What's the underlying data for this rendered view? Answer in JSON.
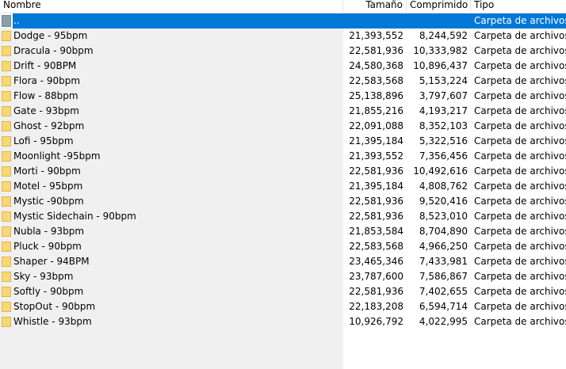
{
  "columns": {
    "name": "Nombre",
    "size": "Tamaño",
    "compressed": "Comprimido",
    "type": "Tipo"
  },
  "parent_row": {
    "name": "..",
    "size": "",
    "compressed": "",
    "type": "Carpeta de archivos"
  },
  "rows": [
    {
      "name": "Dodge - 95bpm",
      "size": "21,393,552",
      "compressed": "8,244,592",
      "type": "Carpeta de archivos"
    },
    {
      "name": "Dracula - 90bpm",
      "size": "22,581,936",
      "compressed": "10,333,982",
      "type": "Carpeta de archivos"
    },
    {
      "name": "Drift - 90BPM",
      "size": "24,580,368",
      "compressed": "10,896,437",
      "type": "Carpeta de archivos"
    },
    {
      "name": "Flora - 90bpm",
      "size": "22,583,568",
      "compressed": "5,153,224",
      "type": "Carpeta de archivos"
    },
    {
      "name": "Flow - 88bpm",
      "size": "25,138,896",
      "compressed": "3,797,607",
      "type": "Carpeta de archivos"
    },
    {
      "name": "Gate - 93bpm",
      "size": "21,855,216",
      "compressed": "4,193,217",
      "type": "Carpeta de archivos"
    },
    {
      "name": "Ghost - 92bpm",
      "size": "22,091,088",
      "compressed": "8,352,103",
      "type": "Carpeta de archivos"
    },
    {
      "name": "Lofi - 95bpm",
      "size": "21,395,184",
      "compressed": "5,322,516",
      "type": "Carpeta de archivos"
    },
    {
      "name": "Moonlight -95bpm",
      "size": "21,393,552",
      "compressed": "7,356,456",
      "type": "Carpeta de archivos"
    },
    {
      "name": "Morti - 90bpm",
      "size": "22,581,936",
      "compressed": "10,492,616",
      "type": "Carpeta de archivos"
    },
    {
      "name": "Motel - 95bpm",
      "size": "21,395,184",
      "compressed": "4,808,762",
      "type": "Carpeta de archivos"
    },
    {
      "name": "Mystic -90bpm",
      "size": "22,581,936",
      "compressed": "9,520,416",
      "type": "Carpeta de archivos"
    },
    {
      "name": "Mystic Sidechain - 90bpm",
      "size": "22,581,936",
      "compressed": "8,523,010",
      "type": "Carpeta de archivos"
    },
    {
      "name": "Nubla - 93bpm",
      "size": "21,853,584",
      "compressed": "8,704,890",
      "type": "Carpeta de archivos"
    },
    {
      "name": "Pluck - 90bpm",
      "size": "22,583,568",
      "compressed": "4,966,250",
      "type": "Carpeta de archivos"
    },
    {
      "name": "Shaper - 94BPM",
      "size": "23,465,346",
      "compressed": "7,433,981",
      "type": "Carpeta de archivos"
    },
    {
      "name": "Sky - 93bpm",
      "size": "23,787,600",
      "compressed": "7,586,867",
      "type": "Carpeta de archivos"
    },
    {
      "name": "Softly - 90bpm",
      "size": "22,581,936",
      "compressed": "7,402,655",
      "type": "Carpeta de archivos"
    },
    {
      "name": "StopOut - 90bpm",
      "size": "22,183,208",
      "compressed": "6,594,714",
      "type": "Carpeta de archivos"
    },
    {
      "name": "Whistle - 93bpm",
      "size": "10,926,792",
      "compressed": "4,022,995",
      "type": "Carpeta de archivos"
    }
  ],
  "icons": {
    "folder": "folder-icon",
    "parent": "parent-folder-icon"
  },
  "colors": {
    "selection": "#0078d7",
    "folder": "#f8d775",
    "pane_background": "#f0f0f0"
  }
}
